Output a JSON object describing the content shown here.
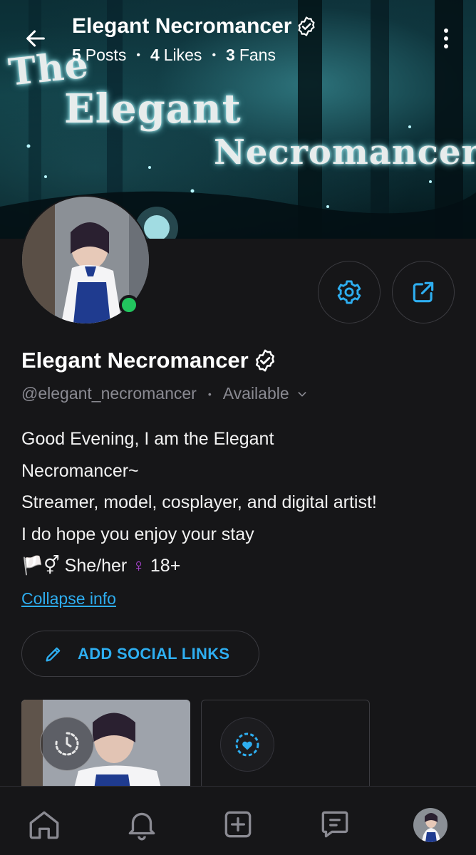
{
  "header": {
    "back_icon": "arrow-left-icon",
    "name": "Elegant Necromancer",
    "verified_icon": "verified-badge-icon",
    "stats": [
      {
        "value": "5",
        "label": "Posts"
      },
      {
        "value": "4",
        "label": "Likes"
      },
      {
        "value": "3",
        "label": "Fans"
      }
    ],
    "menu_icon": "more-vertical-icon"
  },
  "banner": {
    "line1": "The",
    "line2": "Elegant",
    "line3": "Necromancer"
  },
  "profile": {
    "display_name": "Elegant Necromancer",
    "handle": "@elegant_necromancer",
    "status": "Available",
    "online": true,
    "online_color": "#22c55e",
    "bio_lines": [
      "Good Evening, I am the Elegant",
      "Necromancer~",
      "Streamer, model, cosplayer, and digital artist!",
      "I do hope you enjoy your stay"
    ],
    "bio_last": {
      "flag": "🏳️",
      "symbol": "⚥",
      "pronouns": "She/her",
      "venus": "♀",
      "age": "18+"
    },
    "collapse_label": "Collapse info",
    "social_button_label": "ADD SOCIAL LINKS"
  },
  "actions": {
    "settings_icon": "gear-icon",
    "share_icon": "share-icon"
  },
  "theme": {
    "accent": "#2eaef0",
    "background": "#161618",
    "border": "#3b3b40"
  },
  "nav": [
    {
      "name": "home",
      "icon": "home-icon"
    },
    {
      "name": "notifications",
      "icon": "bell-icon"
    },
    {
      "name": "create",
      "icon": "plus-square-icon"
    },
    {
      "name": "messages",
      "icon": "message-icon"
    },
    {
      "name": "profile",
      "icon": "avatar"
    }
  ]
}
